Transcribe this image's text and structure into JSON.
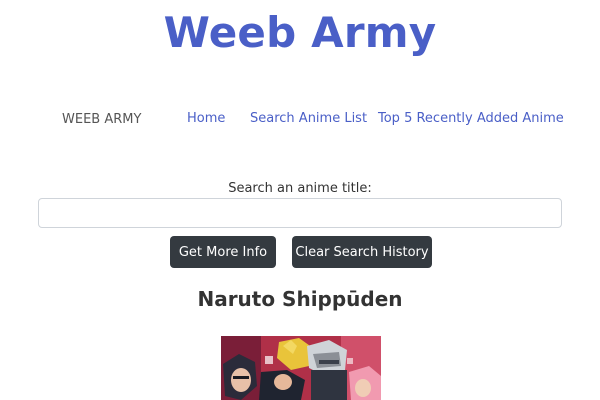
{
  "site": {
    "title": "Weeb Army"
  },
  "navbar": {
    "brand": "WEEB ARMY",
    "links": [
      {
        "label": "Home"
      },
      {
        "label": "Search Anime List"
      },
      {
        "label": "Top 5 Recently Added Anime"
      }
    ]
  },
  "search": {
    "label": "Search an anime title:",
    "value": "",
    "placeholder": ""
  },
  "buttons": {
    "more_info": "Get More Info",
    "clear_history": "Clear Search History"
  },
  "result": {
    "title": "Naruto Shippūden",
    "poster_icon": "anime-poster-image"
  },
  "colors": {
    "accent": "#4a5fc7",
    "button_bg": "#343a40",
    "text": "#333333"
  }
}
